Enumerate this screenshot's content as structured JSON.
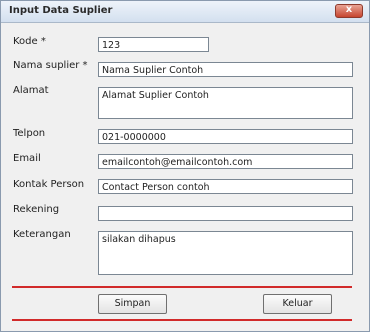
{
  "window": {
    "title": "Input Data Suplier",
    "close_glyph": "x"
  },
  "form": {
    "kode": {
      "label": "Kode *",
      "value": "123"
    },
    "nama": {
      "label": "Nama suplier *",
      "value": "Nama Suplier Contoh"
    },
    "alamat": {
      "label": "Alamat",
      "value": "Alamat Suplier Contoh"
    },
    "telpon": {
      "label": "Telpon",
      "value": "021-0000000"
    },
    "email": {
      "label": "Email",
      "value": "emailcontoh@emailcontoh.com"
    },
    "kontak": {
      "label": "Kontak Person",
      "value": "Contact Person contoh"
    },
    "rekening": {
      "label": "Rekening",
      "value": ""
    },
    "keterangan": {
      "label": "Keterangan",
      "value": "silakan dihapus"
    }
  },
  "buttons": {
    "simpan": "Simpan",
    "keluar": "Keluar"
  },
  "colors": {
    "separator": "#d12a2a",
    "close": "#c6452f"
  }
}
